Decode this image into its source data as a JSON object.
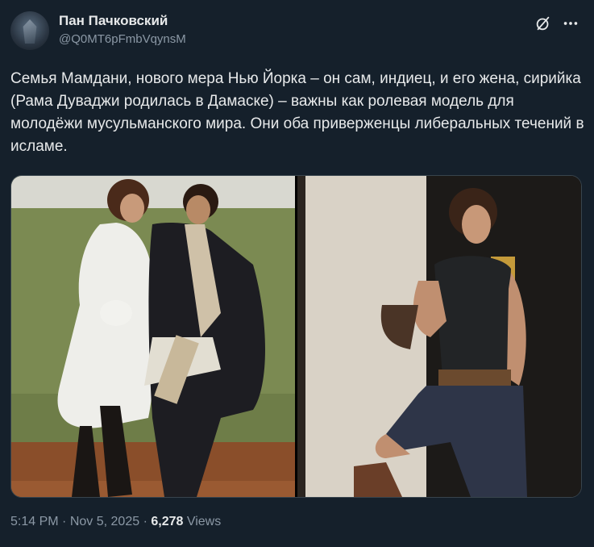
{
  "tweet": {
    "author_name": "Пан Пачковский",
    "author_handle": "@Q0MT6pFmbVqynsM",
    "text": "Семья Мамдани, нового мера Нью Йорка – он сам, индиец, и его жена, сирийка (Рама Дуваджи родилась в Дамаске) – важны как ролевая модель для молодёжи мусульманского мира. Они оба приверженцы либеральных течений в исламе.",
    "time": "5:14 PM",
    "date": "Nov 5, 2025",
    "separator": "·",
    "views_count": "6,278",
    "views_label": "Views"
  },
  "icons": {
    "grok": "grok-icon",
    "more": "more-icon"
  },
  "media": {
    "photos": [
      {
        "name": "wedding-photo"
      },
      {
        "name": "portrait-photo"
      }
    ]
  },
  "colors": {
    "background": "#15202b",
    "text_primary": "#e7e9ea",
    "text_secondary": "#8b98a5",
    "border": "#38444d"
  }
}
